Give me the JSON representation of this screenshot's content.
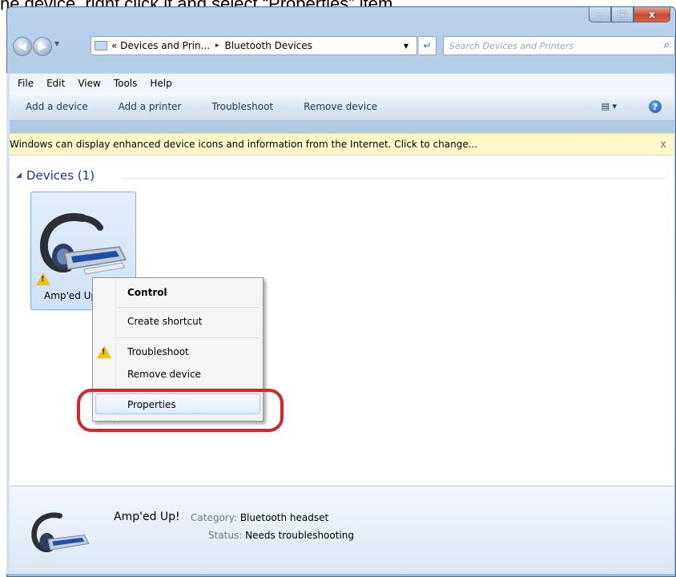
{
  "caption_text": "he device, right click it and select “Properties” item,",
  "window": {
    "caption_buttons": {
      "minimize": "–",
      "maximize": "□",
      "close": "x"
    }
  },
  "address_bar": {
    "back_icon": "back-arrow-icon",
    "forward_icon": "forward-arrow-icon",
    "overflow": "«",
    "crumbs": [
      "Devices and Prin...",
      "Bluetooth Devices"
    ],
    "separator": "▸",
    "refresh_glyph": "↵",
    "search_placeholder": "Search Devices and Printers",
    "search_icon": "⌕"
  },
  "menubar": {
    "items": [
      "File",
      "Edit",
      "View",
      "Tools",
      "Help"
    ]
  },
  "command_bar": {
    "commands": [
      "Add a device",
      "Add a printer",
      "Troubleshoot",
      "Remove device"
    ],
    "view_glyph": "▤ ▾",
    "help_glyph": "?"
  },
  "info_bar": {
    "message": "Windows can display enhanced device icons and information from the Internet. Click to change...",
    "close_glyph": "x"
  },
  "devices_group": {
    "collapse_glyph": "◢",
    "header": "Devices (1)",
    "device_label": "Amp'ed Up!"
  },
  "context_menu": {
    "items": {
      "control": "Control",
      "create_shortcut": "Create shortcut",
      "troubleshoot": "Troubleshoot",
      "remove_device": "Remove device",
      "properties": "Properties"
    },
    "highlighted": "Properties",
    "annotation_color": "#d5242c"
  },
  "details_pane": {
    "name": "Amp'ed Up!",
    "category_label": "Category:",
    "category_value": "Bluetooth headset",
    "status_label": "Status:",
    "status_value": "Needs troubleshooting"
  },
  "colors": {
    "info_bar_bg": "#fdf8c8",
    "group_header": "#1e3287",
    "warning": "#f2c01c"
  }
}
